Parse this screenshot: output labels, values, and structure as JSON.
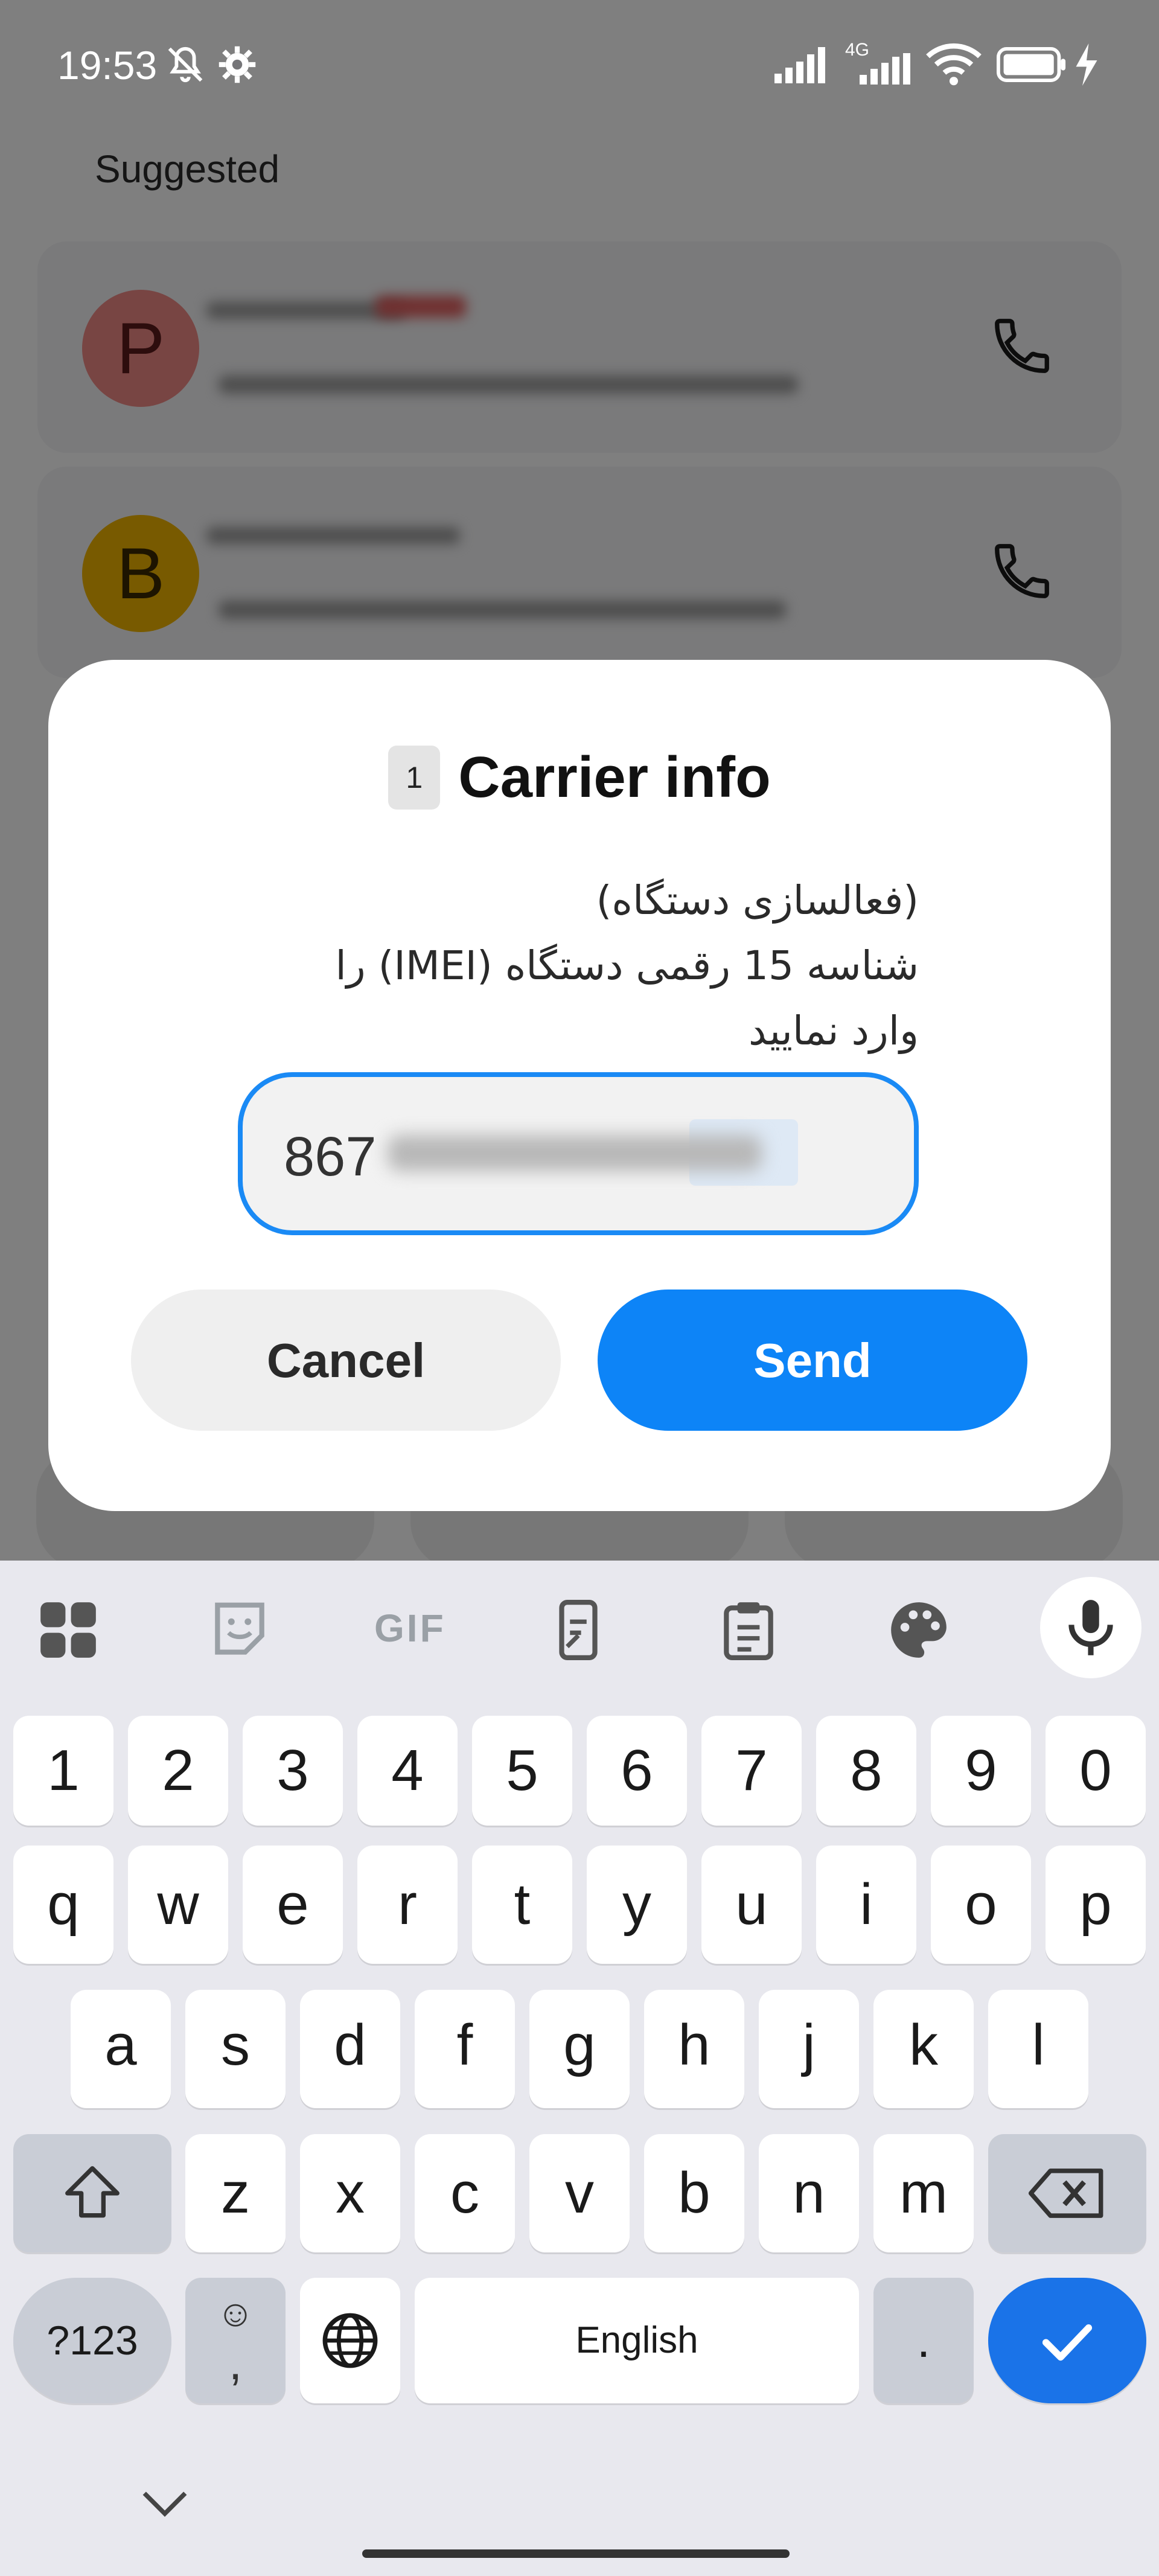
{
  "status_bar": {
    "time": "19:53",
    "network": "4G",
    "icons": [
      "mute-icon",
      "settings-icon",
      "signal-icon",
      "signal-4g-icon",
      "wifi-icon",
      "battery-icon",
      "charging-icon"
    ]
  },
  "background": {
    "section_title": "Suggested",
    "contacts": [
      {
        "initial": "P",
        "avatar_color": "#f08a86"
      },
      {
        "initial": "B",
        "avatar_color": "#f0b400"
      }
    ]
  },
  "dialog": {
    "sim_number": "1",
    "title": "Carrier info",
    "message_line1": "(فعالسازی دستگاه)",
    "message_line2": "شناسه 15 رقمی دستگاه (IMEI) را",
    "message_line3": "وارد نمایید",
    "input_value": "867",
    "cancel_label": "Cancel",
    "send_label": "Send",
    "accent": "#0d84f7"
  },
  "keyboard": {
    "toolbar": [
      "apps-grid-icon",
      "sticker-icon",
      "gif-icon",
      "clipboard-swap-icon",
      "clipboard-icon",
      "palette-icon",
      "microphone-icon"
    ],
    "gif_label": "GIF",
    "row_numbers": [
      "1",
      "2",
      "3",
      "4",
      "5",
      "6",
      "7",
      "8",
      "9",
      "0"
    ],
    "row_1": [
      "q",
      "w",
      "e",
      "r",
      "t",
      "y",
      "u",
      "i",
      "o",
      "p"
    ],
    "row_2": [
      "a",
      "s",
      "d",
      "f",
      "g",
      "h",
      "j",
      "k",
      "l"
    ],
    "row_3": [
      "z",
      "x",
      "c",
      "v",
      "b",
      "n",
      "m"
    ],
    "symbols_label": "?123",
    "emoji_label": "☺",
    "comma_label": ",",
    "space_label": "English",
    "period_label": ".",
    "accent": "#1a73e8"
  }
}
